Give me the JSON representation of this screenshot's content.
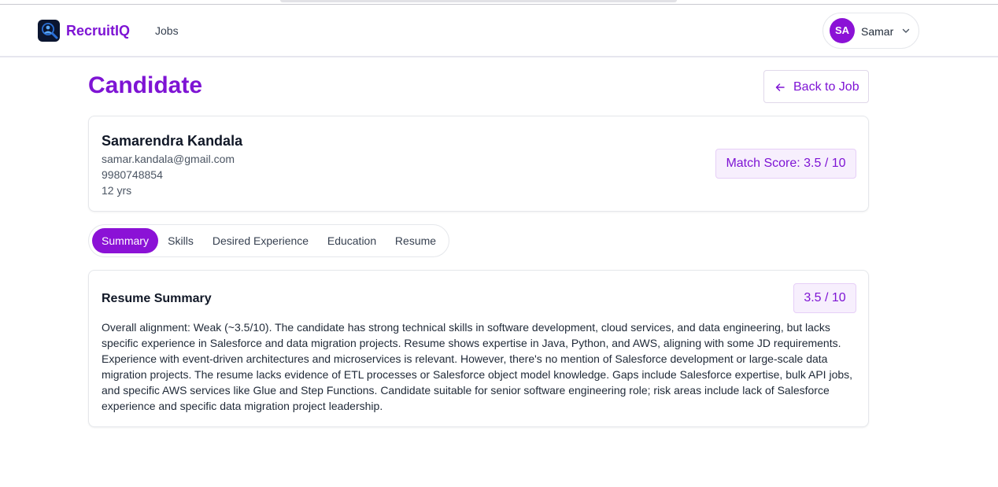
{
  "header": {
    "brand": "RecruitIQ",
    "nav": {
      "jobs": "Jobs"
    },
    "user": {
      "initials": "SA",
      "name": "Samar"
    }
  },
  "page": {
    "title": "Candidate",
    "back_label": "Back to Job"
  },
  "candidate": {
    "name": "Samarendra Kandala",
    "email": "samar.kandala@gmail.com",
    "phone": "9980748854",
    "experience": "12 yrs",
    "match_score_label": "Match Score: 3.5 / 10"
  },
  "tabs": [
    {
      "label": "Summary",
      "active": true
    },
    {
      "label": "Skills",
      "active": false
    },
    {
      "label": "Desired Experience",
      "active": false
    },
    {
      "label": "Education",
      "active": false
    },
    {
      "label": "Resume",
      "active": false
    }
  ],
  "summary": {
    "title": "Resume Summary",
    "score": "3.5 / 10",
    "text": "Overall alignment: Weak (~3.5/10). The candidate has strong technical skills in software development, cloud services, and data engineering, but lacks specific experience in Salesforce and data migration projects. Resume shows expertise in Java, Python, and AWS, aligning with some JD requirements. Experience with event-driven architectures and microservices is relevant. However, there's no mention of Salesforce development or large-scale data migration projects. The resume lacks evidence of ETL processes or Salesforce object model knowledge. Gaps include Salesforce expertise, bulk API jobs, and specific AWS services like Glue and Step Functions. Candidate suitable for senior software engineering role; risk areas include lack of Salesforce experience and specific data migration project leadership."
  },
  "colors": {
    "accent": "#7e14d4",
    "accent_fill": "#8b12d6",
    "badge_bg": "#f7effd",
    "badge_border": "#e6cff7"
  },
  "icons": {
    "logo": "magnifier-person-icon",
    "user_menu": "chevron-down-icon",
    "back": "arrow-left-icon"
  }
}
